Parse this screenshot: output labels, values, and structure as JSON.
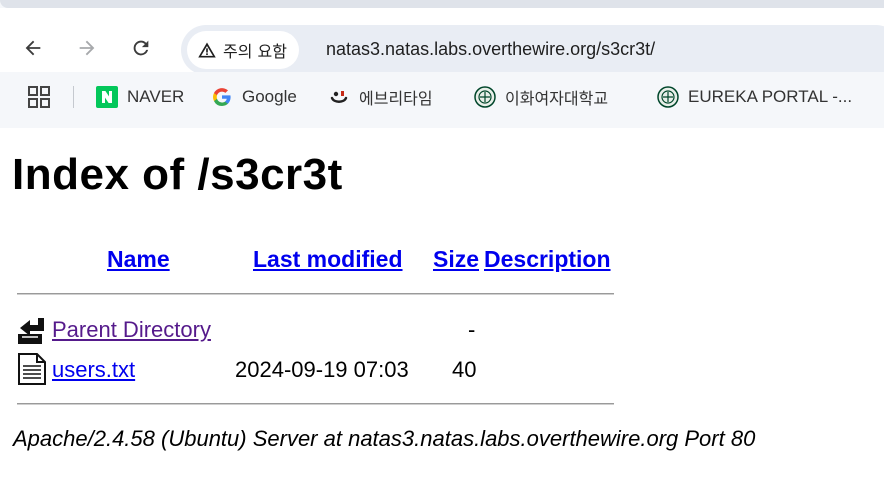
{
  "browser": {
    "security_chip": "주의 요함",
    "url": "natas3.natas.labs.overthewire.org/s3cr3t/",
    "bookmarks": [
      {
        "label": "NAVER",
        "icon": "naver-icon",
        "color": "#03c75a"
      },
      {
        "label": "Google",
        "icon": "google-icon"
      },
      {
        "label": "에브리타임",
        "icon": "everytime-icon",
        "color": "#c62917"
      },
      {
        "label": "이화여자대학교",
        "icon": "ewha-emblem-icon",
        "color": "#00462a"
      },
      {
        "label": "EUREKA PORTAL -...",
        "icon": "ewha-emblem-icon",
        "color": "#00462a"
      }
    ]
  },
  "page": {
    "title": "Index of /s3cr3t",
    "columns": {
      "name": "Name",
      "last_modified": "Last modified",
      "size": "Size",
      "description": "Description"
    },
    "rows": [
      {
        "icon": "back-arrow-icon",
        "name": "Parent Directory",
        "last_modified": "",
        "size": "-",
        "description": ""
      },
      {
        "icon": "text-file-icon",
        "name": "users.txt",
        "last_modified": "2024-09-19 07:03",
        "size": "40",
        "description": ""
      }
    ],
    "address": "Apache/2.4.58 (Ubuntu) Server at natas3.natas.labs.overthewire.org Port 80"
  }
}
